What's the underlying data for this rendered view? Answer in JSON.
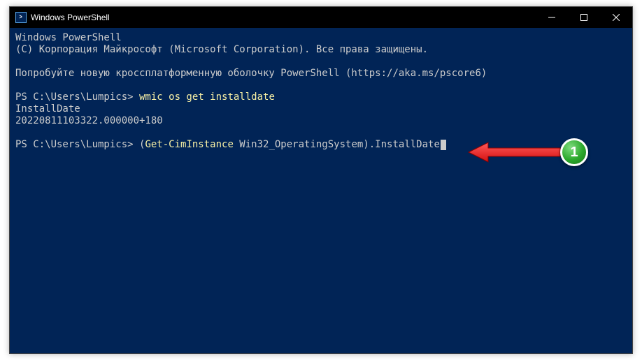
{
  "window": {
    "title": "Windows PowerShell"
  },
  "terminal": {
    "line1": "Windows PowerShell",
    "line2": "(C) Корпорация Майкрософт (Microsoft Corporation). Все права защищены.",
    "line3": "Попробуйте новую кроссплатформенную оболочку PowerShell (https://aka.ms/pscore6)",
    "prompt1_path": "PS C:\\Users\\Lumpics>",
    "cmd1": " wmic os get installdate",
    "output1_header": "InstallDate",
    "output1_value": "20220811103322.000000+180",
    "prompt2_path": "PS C:\\Users\\Lumpics>",
    "cmd2_paren_open": " (",
    "cmd2_cmdlet": "Get-CimInstance",
    "cmd2_arg": " Win32_OperatingSystem",
    "cmd2_rest": ").InstallDate"
  },
  "annotation": {
    "number": "1"
  }
}
